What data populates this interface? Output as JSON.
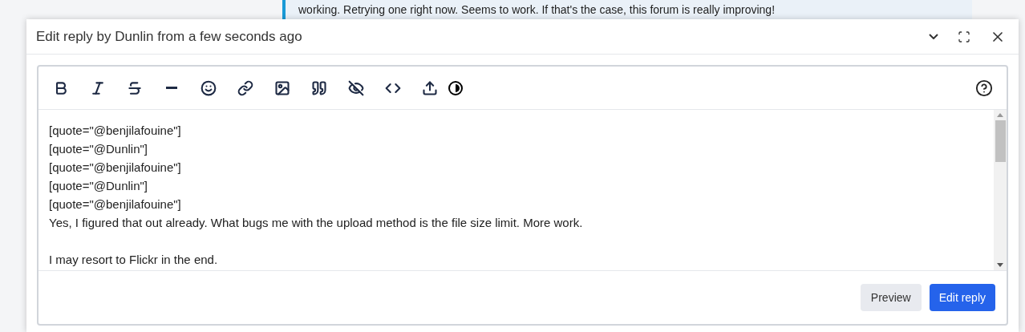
{
  "background_post": {
    "text": "working. Retrying one right now. Seems to work. If that's the case, this forum is really improving!"
  },
  "dialog": {
    "title": "Edit reply by Dunlin from a few seconds ago"
  },
  "toolbar": [
    {
      "kind": "bold"
    },
    {
      "kind": "italic"
    },
    {
      "kind": "strike"
    },
    {
      "kind": "rule"
    },
    {
      "kind": "emoji"
    },
    {
      "kind": "link"
    },
    {
      "kind": "image"
    },
    {
      "kind": "quote"
    },
    {
      "kind": "hide"
    },
    {
      "kind": "code"
    },
    {
      "kind": "upload"
    },
    {
      "kind": "theme"
    }
  ],
  "editor": {
    "paragraphs": [
      [
        "[quote=\"@benjilafouine\"]",
        "[quote=\"@Dunlin\"]",
        "[quote=\"@benjilafouine\"]",
        "[quote=\"@Dunlin\"]",
        "[quote=\"@benjilafouine\"]",
        "Yes, I figured that out already. What bugs me with the upload method is the file size limit. More work."
      ],
      [
        "I may resort to Flickr in the end."
      ]
    ]
  },
  "buttons": [
    {
      "label": "Preview",
      "kind": "secondary"
    },
    {
      "label": "Edit reply",
      "kind": "primary"
    }
  ]
}
